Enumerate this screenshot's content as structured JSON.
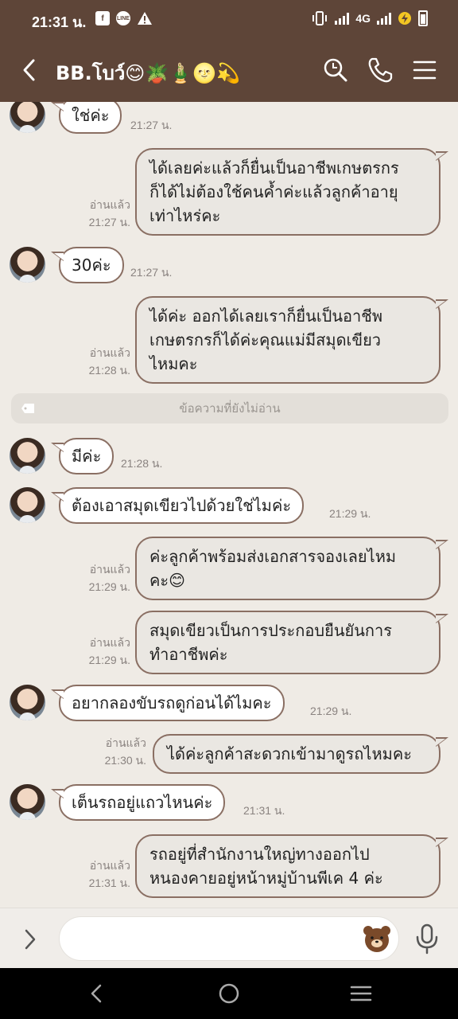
{
  "status_bar": {
    "time": "21:31 น.",
    "network": "4G"
  },
  "header": {
    "title": "BB.โบว์😊🪴🎍🌝💫"
  },
  "messages": [
    {
      "dir": "in",
      "lines": [
        "ใช่ค่ะ"
      ],
      "time": "21:27 น."
    },
    {
      "dir": "out",
      "lines": [
        "ได้เลยค่ะแล้วก็ยื่นเป็นอาชีพเกษตรกร",
        "ก็ได้ไม่ต้องใช้คนค้ำค่ะแล้วลูกค้าอายุ",
        "เท่าไหร่คะ"
      ],
      "read": "อ่านแล้ว",
      "time": "21:27 น."
    },
    {
      "dir": "in",
      "lines": [
        "30ค่ะ"
      ],
      "time": "21:27 น."
    },
    {
      "dir": "out",
      "lines": [
        "ได้ค่ะ ออกได้เลยเราก็ยื่นเป็นอาชีพ",
        "เกษตรกรก็ได้ค่ะคุณแม่มีสมุดเขียว",
        "ไหมคะ"
      ],
      "read": "อ่านแล้ว",
      "time": "21:28 น."
    },
    {
      "dir": "in",
      "lines": [
        "มีค่ะ"
      ],
      "time": "21:28 น."
    },
    {
      "dir": "in",
      "lines": [
        "ต้องเอาสมุดเขียวไปด้วยใช่ไมค่ะ"
      ],
      "time": "21:29 น."
    },
    {
      "dir": "out",
      "lines": [
        "ค่ะลูกค้าพร้อมส่งเอกสารจองเลยไหม",
        "คะ😊"
      ],
      "read": "อ่านแล้ว",
      "time": "21:29 น."
    },
    {
      "dir": "out",
      "lines": [
        "สมุดเขียวเป็นการประกอบยืนยันการ",
        "ทำอาชีพค่ะ"
      ],
      "read": "อ่านแล้ว",
      "time": "21:29 น."
    },
    {
      "dir": "in",
      "lines": [
        "อยากลองขับรถดูก่อนได้ไมคะ"
      ],
      "time": "21:29 น."
    },
    {
      "dir": "out",
      "lines": [
        "ได้ค่ะลูกค้าสะดวกเข้ามาดูรถไหมคะ"
      ],
      "read": "อ่านแล้ว",
      "time": "21:30 น."
    },
    {
      "dir": "in",
      "lines": [
        "เต็นรถอยู่แถวไหนค่ะ"
      ],
      "time": "21:31 น."
    },
    {
      "dir": "out",
      "lines": [
        "รถอยู่ที่สำนักงานใหญ่ทางออกไป",
        "หนองคายอยู่หน้าหมู่บ้านพีเค 4 ค่ะ"
      ],
      "read": "อ่านแล้ว",
      "time": "21:31 น."
    }
  ],
  "unread_divider": "ข้อความที่ยังไม่อ่าน",
  "composer": {
    "placeholder": ""
  },
  "colors": {
    "header_bg": "#5e4538",
    "chat_bg": "#efebe5",
    "bubble_border": "#8a6f63"
  }
}
